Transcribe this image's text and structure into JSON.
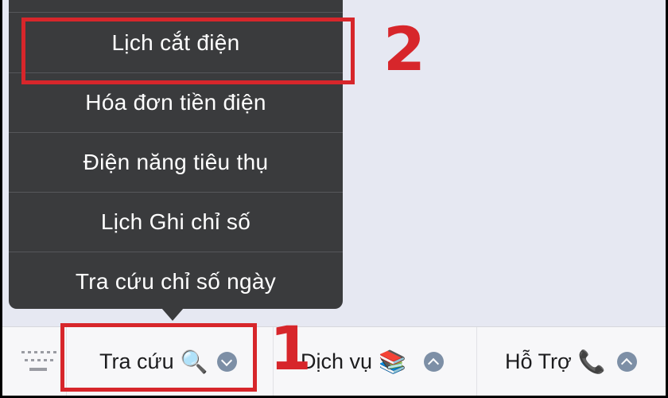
{
  "menu": {
    "items": [
      {
        "label": "Lịch cắt điện"
      },
      {
        "label": "Hóa đơn tiền điện"
      },
      {
        "label": "Điện năng tiêu thụ"
      },
      {
        "label": "Lịch Ghi chỉ số"
      },
      {
        "label": "Tra cứu chỉ số ngày"
      }
    ]
  },
  "bottom_bar": {
    "tabs": [
      {
        "label": "Tra cứu",
        "icon": "magnifier-icon",
        "icon_glyph": "🔍"
      },
      {
        "label": "Dịch vụ",
        "icon": "books-icon",
        "icon_glyph": "📚"
      },
      {
        "label": "Hỗ Trợ",
        "icon": "phone-icon",
        "icon_glyph": "📞"
      }
    ]
  },
  "annotations": {
    "step1": "1",
    "step2": "2",
    "color": "#d7262b"
  },
  "colors": {
    "menu_bg": "#3a3b3d",
    "screen_bg": "#e6e8f2",
    "bar_bg": "#f7f7f9",
    "chevron": "#7d8fa6"
  }
}
